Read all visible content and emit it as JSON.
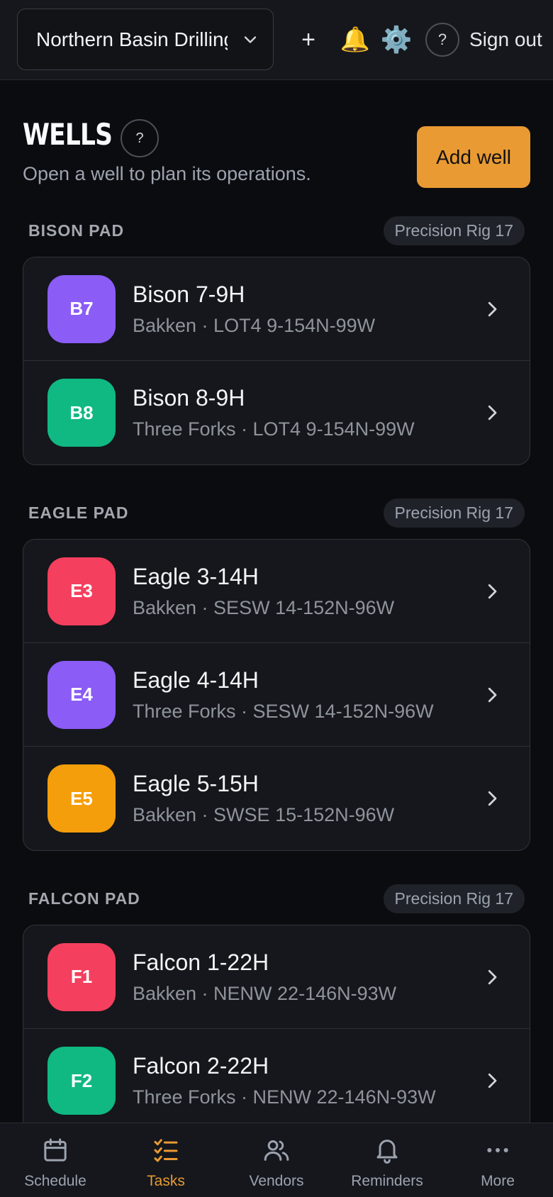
{
  "header": {
    "organization": "Northern Basin Drilling",
    "add_icon": "+",
    "notifications_icon": "🔔",
    "settings_icon": "⚙️",
    "help_icon": "?",
    "sign_out": "Sign out"
  },
  "page": {
    "title": "WELLS",
    "help_icon": "?",
    "subtitle": "Open a well to plan its operations.",
    "add_button": "Add well"
  },
  "sections": [
    {
      "title": "BISON PAD",
      "rig": "Precision Rig 17",
      "wells": [
        {
          "badge": "B7",
          "color": "#8b5cf6",
          "name": "Bison 7-9H",
          "detail": "Bakken · LOT4 9-154N-99W"
        },
        {
          "badge": "B8",
          "color": "#10b981",
          "name": "Bison 8-9H",
          "detail": "Three Forks · LOT4 9-154N-99W"
        }
      ]
    },
    {
      "title": "EAGLE PAD",
      "rig": "Precision Rig 17",
      "wells": [
        {
          "badge": "E3",
          "color": "#f43f5e",
          "name": "Eagle 3-14H",
          "detail": "Bakken · SESW 14-152N-96W"
        },
        {
          "badge": "E4",
          "color": "#8b5cf6",
          "name": "Eagle 4-14H",
          "detail": "Three Forks · SESW 14-152N-96W"
        },
        {
          "badge": "E5",
          "color": "#f59e0b",
          "name": "Eagle 5-15H",
          "detail": "Bakken · SWSE 15-152N-96W"
        }
      ]
    },
    {
      "title": "FALCON PAD",
      "rig": "Precision Rig 17",
      "wells": [
        {
          "badge": "F1",
          "color": "#f43f5e",
          "name": "Falcon 1-22H",
          "detail": "Bakken · NENW 22-146N-93W"
        },
        {
          "badge": "F2",
          "color": "#10b981",
          "name": "Falcon 2-22H",
          "detail": "Three Forks · NENW 22-146N-93W"
        }
      ]
    }
  ],
  "nav": {
    "active": "Tasks",
    "items": [
      {
        "label": "Schedule",
        "icon": "calendar-icon"
      },
      {
        "label": "Tasks",
        "icon": "checklist-icon"
      },
      {
        "label": "Vendors",
        "icon": "users-icon"
      },
      {
        "label": "Reminders",
        "icon": "bell-icon"
      },
      {
        "label": "More",
        "icon": "more-icon"
      }
    ]
  },
  "colors": {
    "accent": "#e99a33",
    "background": "#0b0c0f",
    "surface": "#15171c"
  }
}
